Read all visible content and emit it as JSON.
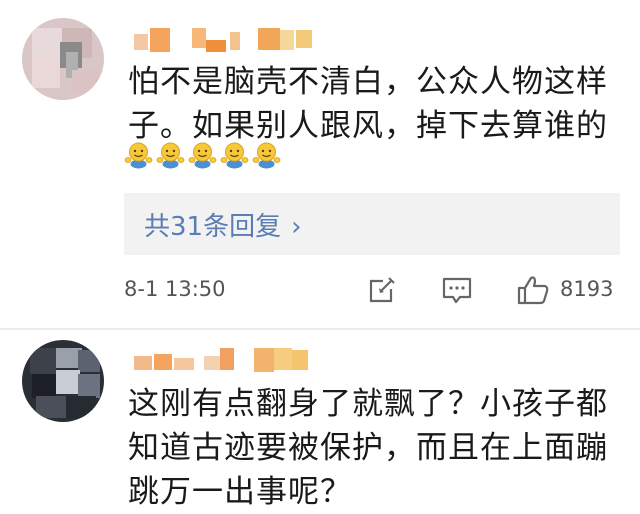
{
  "comments": [
    {
      "text": "怕不是脑壳不清白，公众人物这样\n子。如果别人跟风，掉下去算谁的",
      "emoji_name": "shrug-emoji",
      "emoji_count": 5,
      "replies_label": "共31条回复",
      "replies_chevron": "›",
      "time": "8-1 13:50",
      "like_count": "8193"
    },
    {
      "text": "这刚有点翻身了就飘了？小孩子都\n知道古迹要被保护，而且在上面蹦\n跳万一出事呢？"
    }
  ],
  "icons": {
    "share": "share-icon",
    "comment": "comment-icon",
    "like": "thumbs-up-icon"
  },
  "colors": {
    "link": "#5a7db3",
    "reply_bg": "#f2f2f2",
    "meta_text": "#555555"
  }
}
